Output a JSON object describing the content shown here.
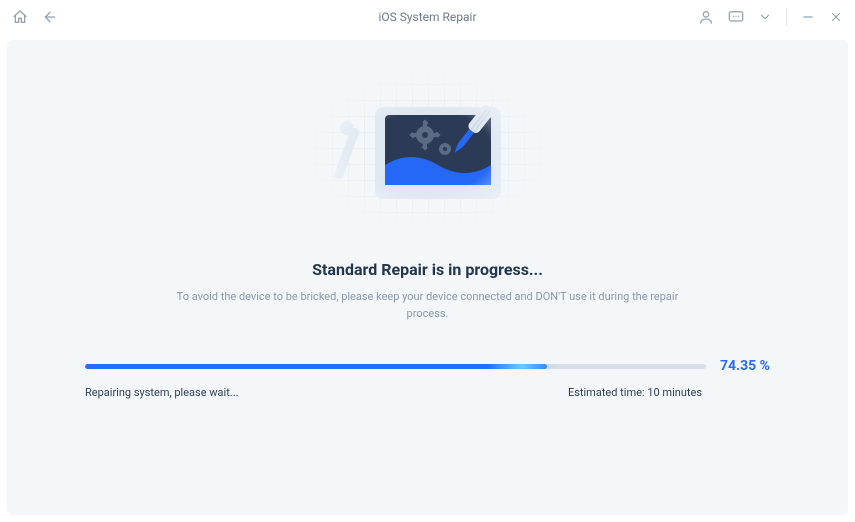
{
  "window": {
    "title": "iOS System Repair"
  },
  "main": {
    "heading": "Standard Repair is in progress...",
    "subtext": "To avoid the device to be bricked, please keep your device connected and DON'T use it during the repair process."
  },
  "progress": {
    "percent_value": 74.35,
    "percent_label": "74.35 %",
    "status_text": "Repairing system, please wait...",
    "eta_prefix": "Estimated time: ",
    "eta_value": "10 minutes"
  },
  "colors": {
    "accent": "#256cfb"
  }
}
